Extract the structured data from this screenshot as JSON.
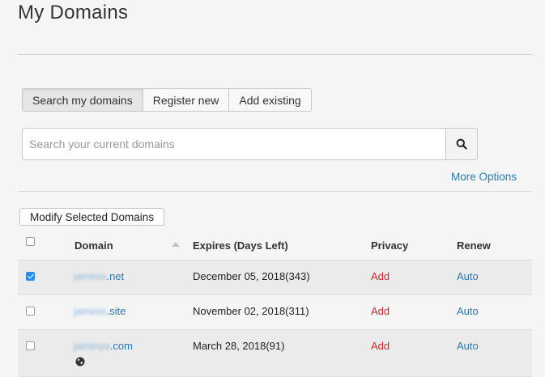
{
  "page": {
    "title": "My Domains"
  },
  "tabs": [
    {
      "label": "Search my domains",
      "active": true
    },
    {
      "label": "Register new"
    },
    {
      "label": "Add existing"
    }
  ],
  "search": {
    "placeholder": "Search your current domains",
    "value": "",
    "button_icon": "search-icon"
  },
  "more_options": "More Options",
  "modify_button": "Modify Selected Domains",
  "table": {
    "columns": {
      "domain": "Domain",
      "expires": "Expires (Days Left)",
      "privacy": "Privacy",
      "renew": "Renew"
    },
    "sort_icon": "sort-up-icon",
    "rows": [
      {
        "checked": true,
        "domain_blurred": "jaminix",
        "domain_ext": ".net",
        "expires": "December 05, 2018(343)",
        "privacy": "Add",
        "renew": "Auto"
      },
      {
        "checked": false,
        "domain_blurred": "jaminix",
        "domain_ext": ".site",
        "expires": "November 02, 2018(311)",
        "privacy": "Add",
        "renew": "Auto"
      },
      {
        "checked": false,
        "domain_blurred": "jaminya",
        "domain_ext": ".com",
        "expires": "March 28, 2018(91)",
        "privacy": "Add",
        "renew": "Auto",
        "icon": "globe-icon"
      }
    ]
  },
  "colors": {
    "link": "#2a7ab8",
    "privacy_add": "#d9262b",
    "checkbox_checked": "#2f8be8"
  }
}
